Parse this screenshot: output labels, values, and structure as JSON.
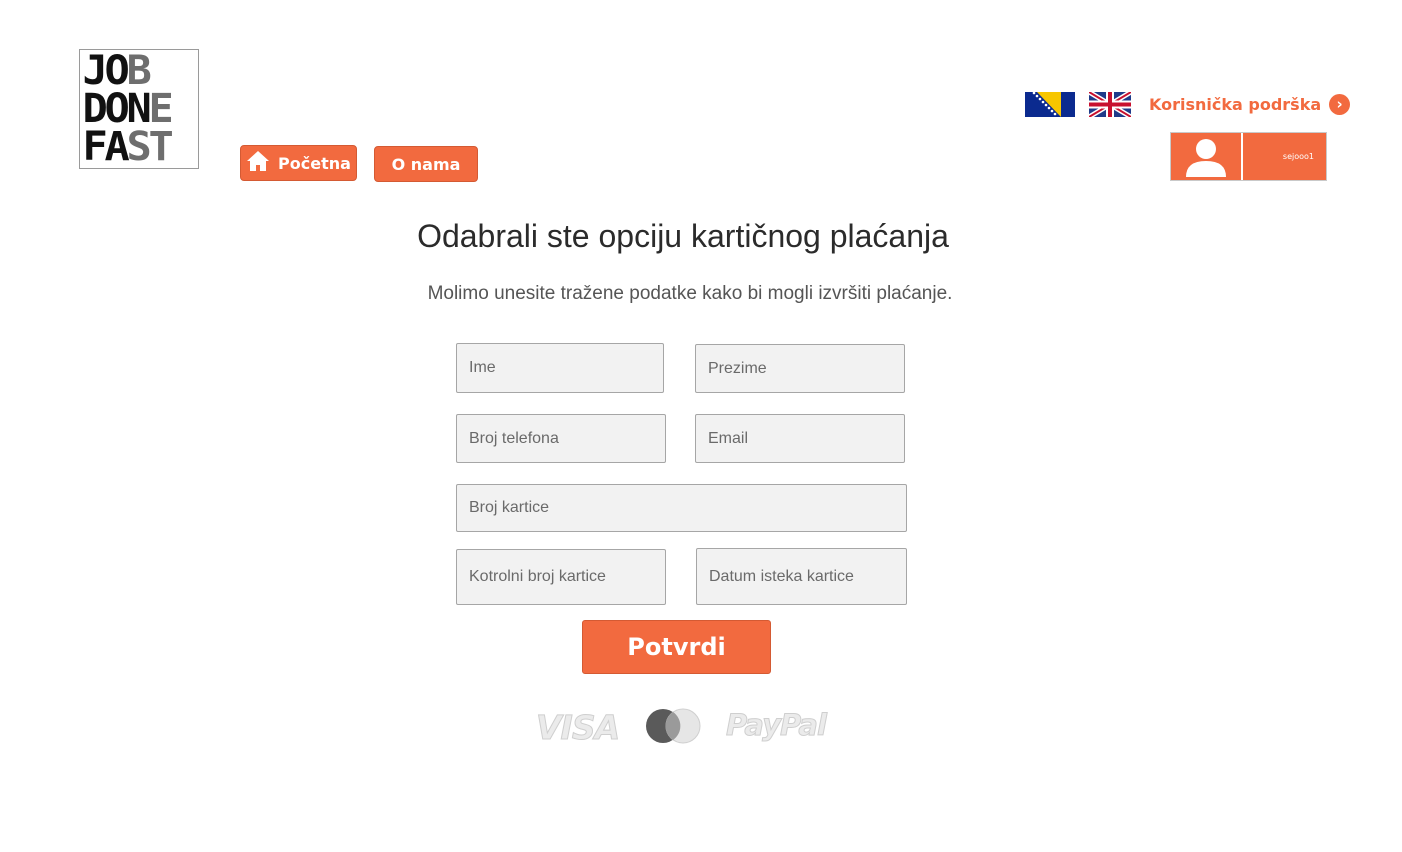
{
  "logo": {
    "line1": [
      "J",
      "O",
      "B"
    ],
    "line2": [
      "D",
      "O",
      "N",
      "E"
    ],
    "line3": [
      "F",
      "A",
      "S",
      "T"
    ]
  },
  "nav": {
    "home_label": "Početna",
    "about_label": "O nama"
  },
  "header": {
    "support_label": "Korisnička podrška",
    "username": "sejooo1"
  },
  "main": {
    "title": "Odabrali ste opciju kartičnog plaćanja",
    "subtitle": "Molimo unesite tražene podatke kako bi mogli izvršiti plaćanje."
  },
  "form": {
    "first_name_placeholder": "Ime",
    "last_name_placeholder": "Prezime",
    "phone_placeholder": "Broj telefona",
    "email_placeholder": "Email",
    "card_number_placeholder": "Broj kartice",
    "card_control_placeholder": "Kotrolni broj kartice",
    "card_expiry_placeholder": "Datum isteka kartice",
    "submit_label": "Potvrdi"
  },
  "payment": {
    "visa": "VISA",
    "paypal": "PayPal"
  },
  "colors": {
    "accent": "#f26a3f",
    "field_bg": "#f2f2f2"
  }
}
